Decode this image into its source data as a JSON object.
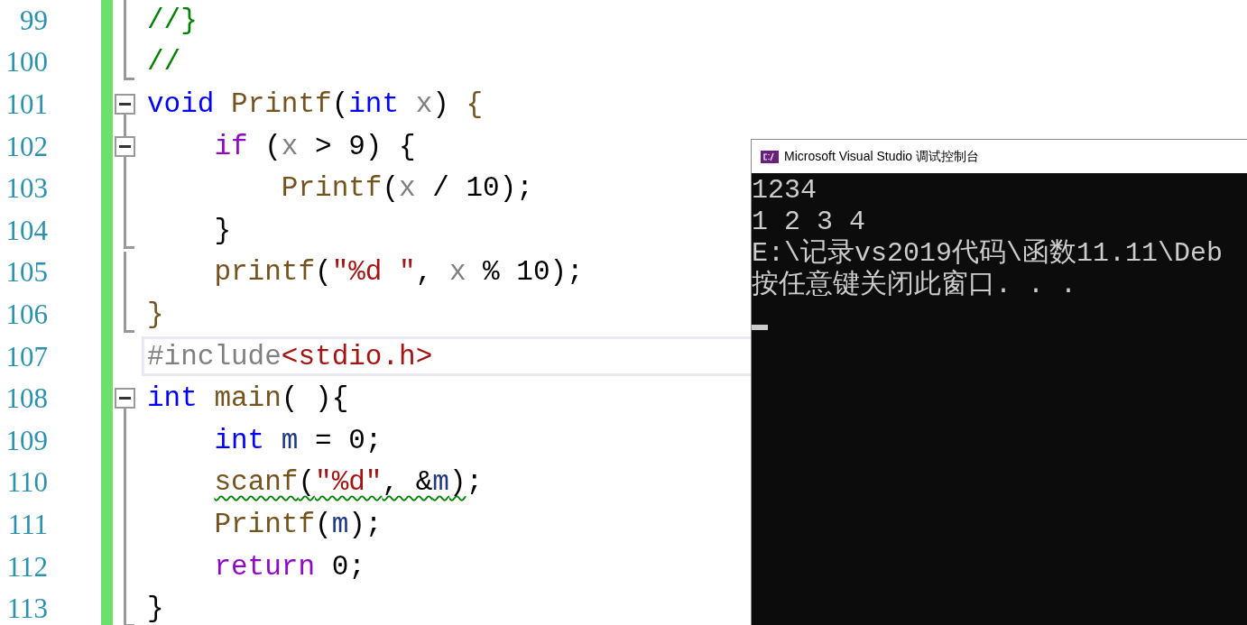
{
  "editor": {
    "lines": [
      {
        "number": "99",
        "current": false,
        "fold": {
          "kind": "body"
        },
        "tokens": [
          {
            "text": "//}",
            "kind": "comment"
          }
        ]
      },
      {
        "number": "100",
        "current": false,
        "fold": {
          "kind": "end"
        },
        "tokens": [
          {
            "text": "//",
            "kind": "comment"
          }
        ]
      },
      {
        "number": "101",
        "current": false,
        "fold": {
          "kind": "start",
          "expanded": true
        },
        "tokens": [
          {
            "text": "void",
            "kind": "keyword"
          },
          {
            "text": " Printf",
            "kind": "function"
          },
          {
            "text": "(",
            "kind": "punct"
          },
          {
            "text": "int",
            "kind": "keyword"
          },
          {
            "text": " x",
            "kind": "param"
          },
          {
            "text": ") ",
            "kind": "punct"
          },
          {
            "text": "{",
            "kind": "function"
          }
        ]
      },
      {
        "number": "102",
        "current": false,
        "fold": {
          "kind": "start",
          "expanded": true
        },
        "tokens": [
          {
            "text": "    if",
            "kind": "control"
          },
          {
            "text": " (",
            "kind": "punct"
          },
          {
            "text": "x",
            "kind": "param"
          },
          {
            "text": " > 9) {",
            "kind": "punct"
          }
        ]
      },
      {
        "number": "103",
        "current": false,
        "fold": {
          "kind": "body"
        },
        "tokens": [
          {
            "text": "        Printf",
            "kind": "function"
          },
          {
            "text": "(",
            "kind": "punct"
          },
          {
            "text": "x",
            "kind": "param"
          },
          {
            "text": " / 10);",
            "kind": "punct"
          }
        ]
      },
      {
        "number": "104",
        "current": false,
        "fold": {
          "kind": "end"
        },
        "tokens": [
          {
            "text": "    }",
            "kind": "punct"
          }
        ]
      },
      {
        "number": "105",
        "current": false,
        "fold": {
          "kind": "body"
        },
        "tokens": [
          {
            "text": "    printf",
            "kind": "function"
          },
          {
            "text": "(",
            "kind": "punct"
          },
          {
            "text": "\"%d \"",
            "kind": "string"
          },
          {
            "text": ", ",
            "kind": "punct"
          },
          {
            "text": "x",
            "kind": "param"
          },
          {
            "text": " % 10);",
            "kind": "punct"
          }
        ]
      },
      {
        "number": "106",
        "current": false,
        "fold": {
          "kind": "end"
        },
        "tokens": [
          {
            "text": "}",
            "kind": "function"
          }
        ]
      },
      {
        "number": "107",
        "current": true,
        "fold": {
          "kind": "none"
        },
        "tokens": [
          {
            "text": "#include",
            "kind": "preprocessor"
          },
          {
            "text": "<stdio.h>",
            "kind": "string"
          }
        ]
      },
      {
        "number": "108",
        "current": false,
        "fold": {
          "kind": "start",
          "expanded": true
        },
        "tokens": [
          {
            "text": "int",
            "kind": "keyword"
          },
          {
            "text": " main",
            "kind": "function"
          },
          {
            "text": "( ){",
            "kind": "punct"
          }
        ]
      },
      {
        "number": "109",
        "current": false,
        "fold": {
          "kind": "body"
        },
        "tokens": [
          {
            "text": "    int",
            "kind": "keyword"
          },
          {
            "text": " m",
            "kind": "variable"
          },
          {
            "text": " = 0;",
            "kind": "punct"
          }
        ]
      },
      {
        "number": "110",
        "current": false,
        "fold": {
          "kind": "body"
        },
        "tokens": [
          {
            "text": "    scanf",
            "kind": "function",
            "underlined": true
          },
          {
            "text": "(",
            "kind": "punct",
            "underlined": true
          },
          {
            "text": "\"%d\"",
            "kind": "string",
            "underlined": true
          },
          {
            "text": ", &",
            "kind": "punct",
            "underlined": true
          },
          {
            "text": "m",
            "kind": "variable",
            "underlined": true
          },
          {
            "text": ")",
            "kind": "punct",
            "underlined": true
          },
          {
            "text": ";",
            "kind": "punct",
            "underlined": false
          }
        ]
      },
      {
        "number": "111",
        "current": false,
        "fold": {
          "kind": "body"
        },
        "tokens": [
          {
            "text": "    Printf",
            "kind": "function"
          },
          {
            "text": "(",
            "kind": "punct"
          },
          {
            "text": "m",
            "kind": "variable"
          },
          {
            "text": ");",
            "kind": "punct"
          }
        ]
      },
      {
        "number": "112",
        "current": false,
        "fold": {
          "kind": "body"
        },
        "tokens": [
          {
            "text": "    return",
            "kind": "control"
          },
          {
            "text": " 0;",
            "kind": "punct"
          }
        ]
      },
      {
        "number": "113",
        "current": false,
        "fold": {
          "kind": "end"
        },
        "tokens": [
          {
            "text": "}",
            "kind": "punct"
          }
        ]
      }
    ]
  },
  "console": {
    "title": "Microsoft Visual Studio 调试控制台",
    "output": [
      "1234",
      "1 2 3 4",
      "E:\\记录vs2019代码\\函数11.11\\Deb",
      "按任意键关闭此窗口. . ."
    ]
  }
}
